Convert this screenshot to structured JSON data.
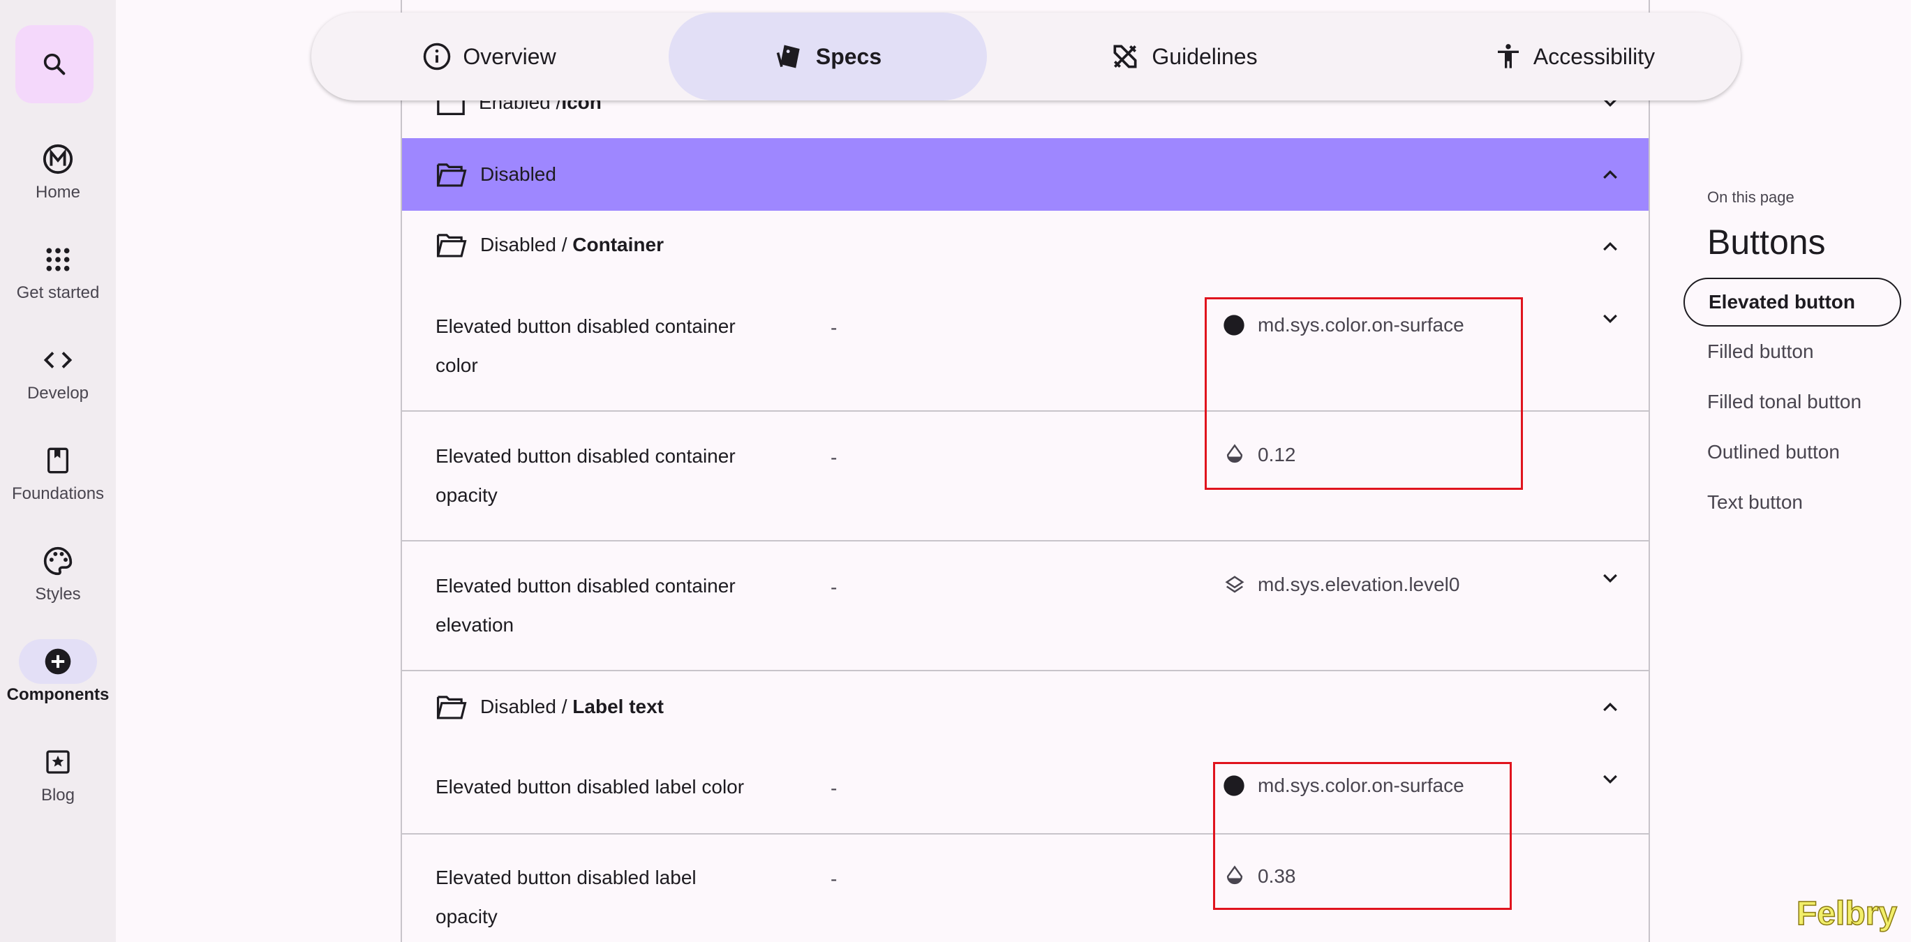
{
  "rail": {
    "items": [
      {
        "label": "Home",
        "icon": "material-m-logo-icon"
      },
      {
        "label": "Get started",
        "icon": "grid-dots-icon"
      },
      {
        "label": "Develop",
        "icon": "code-brackets-icon"
      },
      {
        "label": "Foundations",
        "icon": "bookmark-icon"
      },
      {
        "label": "Styles",
        "icon": "palette-icon"
      },
      {
        "label": "Components",
        "icon": "add-circle-icon",
        "active": true
      },
      {
        "label": "Blog",
        "icon": "star-box-icon"
      }
    ]
  },
  "tabs": [
    {
      "label": "Overview",
      "icon": "info-icon"
    },
    {
      "label": "Specs",
      "icon": "specs-tag-icon",
      "active": true
    },
    {
      "label": "Guidelines",
      "icon": "ruler-pencil-icon"
    },
    {
      "label": "Accessibility",
      "icon": "accessibility-icon"
    }
  ],
  "spec": {
    "top_partial": {
      "prefix": "Enabled / ",
      "bold": "Icon"
    },
    "disabled_header": "Disabled",
    "container_group": {
      "prefix": "Disabled / ",
      "bold": "Container"
    },
    "label_group": {
      "prefix": "Disabled / ",
      "bold": "Label text"
    },
    "rows": [
      {
        "name_line1": "Elevated button disabled container",
        "name_line2": "color",
        "default": "-",
        "value": "md.sys.color.on-surface",
        "icon": "color-dot-icon"
      },
      {
        "name_line1": "Elevated button disabled container",
        "name_line2": "opacity",
        "default": "-",
        "value": "0.12",
        "icon": "opacity-drop-icon"
      },
      {
        "name_line1": "Elevated button disabled container",
        "name_line2": "elevation",
        "default": "-",
        "value": "md.sys.elevation.level0",
        "icon": "layers-icon"
      },
      {
        "name_line1": "Elevated button disabled label color",
        "name_line2": "",
        "default": "-",
        "value": "md.sys.color.on-surface",
        "icon": "color-dot-icon"
      },
      {
        "name_line1": "Elevated button disabled label",
        "name_line2": "opacity",
        "default": "-",
        "value": "0.38",
        "icon": "opacity-drop-icon"
      }
    ]
  },
  "toc": {
    "caption": "On this page",
    "title": "Buttons",
    "items": [
      {
        "label": "Elevated button",
        "active": true
      },
      {
        "label": "Filled button"
      },
      {
        "label": "Filled tonal button"
      },
      {
        "label": "Outlined button"
      },
      {
        "label": "Text button"
      }
    ]
  },
  "watermark": "Felbry",
  "colors": {
    "accent_purple": "#9e87ff",
    "highlight_red": "#e0141e",
    "active_tab_bg": "#e2dff6",
    "search_fab_bg": "#f4d8fb"
  }
}
